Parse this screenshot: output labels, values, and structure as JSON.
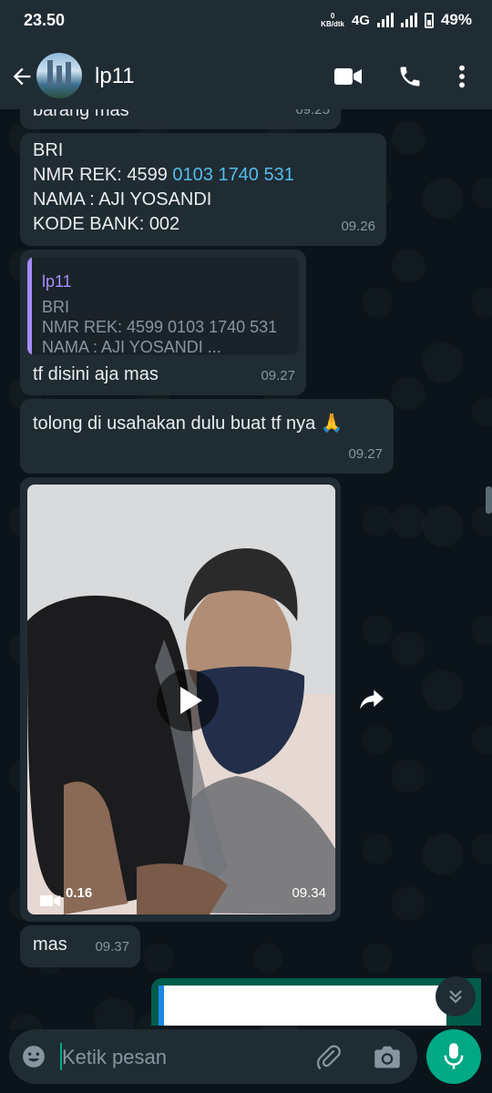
{
  "status_bar": {
    "time": "23.50",
    "data_rate_value": "0",
    "data_rate_unit": "KB/dtk",
    "network": "4G",
    "battery": "49%"
  },
  "header": {
    "contact_name": "lp11",
    "icons": [
      "back-arrow-icon",
      "video-call-icon",
      "voice-call-icon",
      "more-options-icon"
    ]
  },
  "messages": [
    {
      "id": "m0",
      "text": "barang mas",
      "time": "09.25"
    },
    {
      "id": "m1",
      "lines": [
        "BRI",
        "NMR REK: 4599 ",
        "NAMA : AJI YOSANDI",
        "KODE BANK: 002"
      ],
      "account_link": "0103 1740 531",
      "time": "09.26"
    },
    {
      "id": "m2",
      "quote": {
        "author": "lp11",
        "lines": [
          "BRI",
          "NMR REK: 4599 0103 1740 531",
          "NAMA : AJI YOSANDI ..."
        ]
      },
      "text": "tf disini aja mas",
      "time": "09.27"
    },
    {
      "id": "m3",
      "text": "tolong di usahakan dulu buat tf nya 🙏",
      "time": "09.27"
    },
    {
      "id": "m4",
      "type": "video",
      "duration": "0.16",
      "time": "09.34"
    },
    {
      "id": "m5",
      "text": "mas",
      "time": "09.37"
    }
  ],
  "composer": {
    "placeholder": "Ketik pesan"
  },
  "colors": {
    "background": "#0b141a",
    "bar": "#1f2c34",
    "bubble_in": "#202c33",
    "accent": "#00a884",
    "link": "#53bdeb",
    "quote_author": "#a78bfa"
  }
}
